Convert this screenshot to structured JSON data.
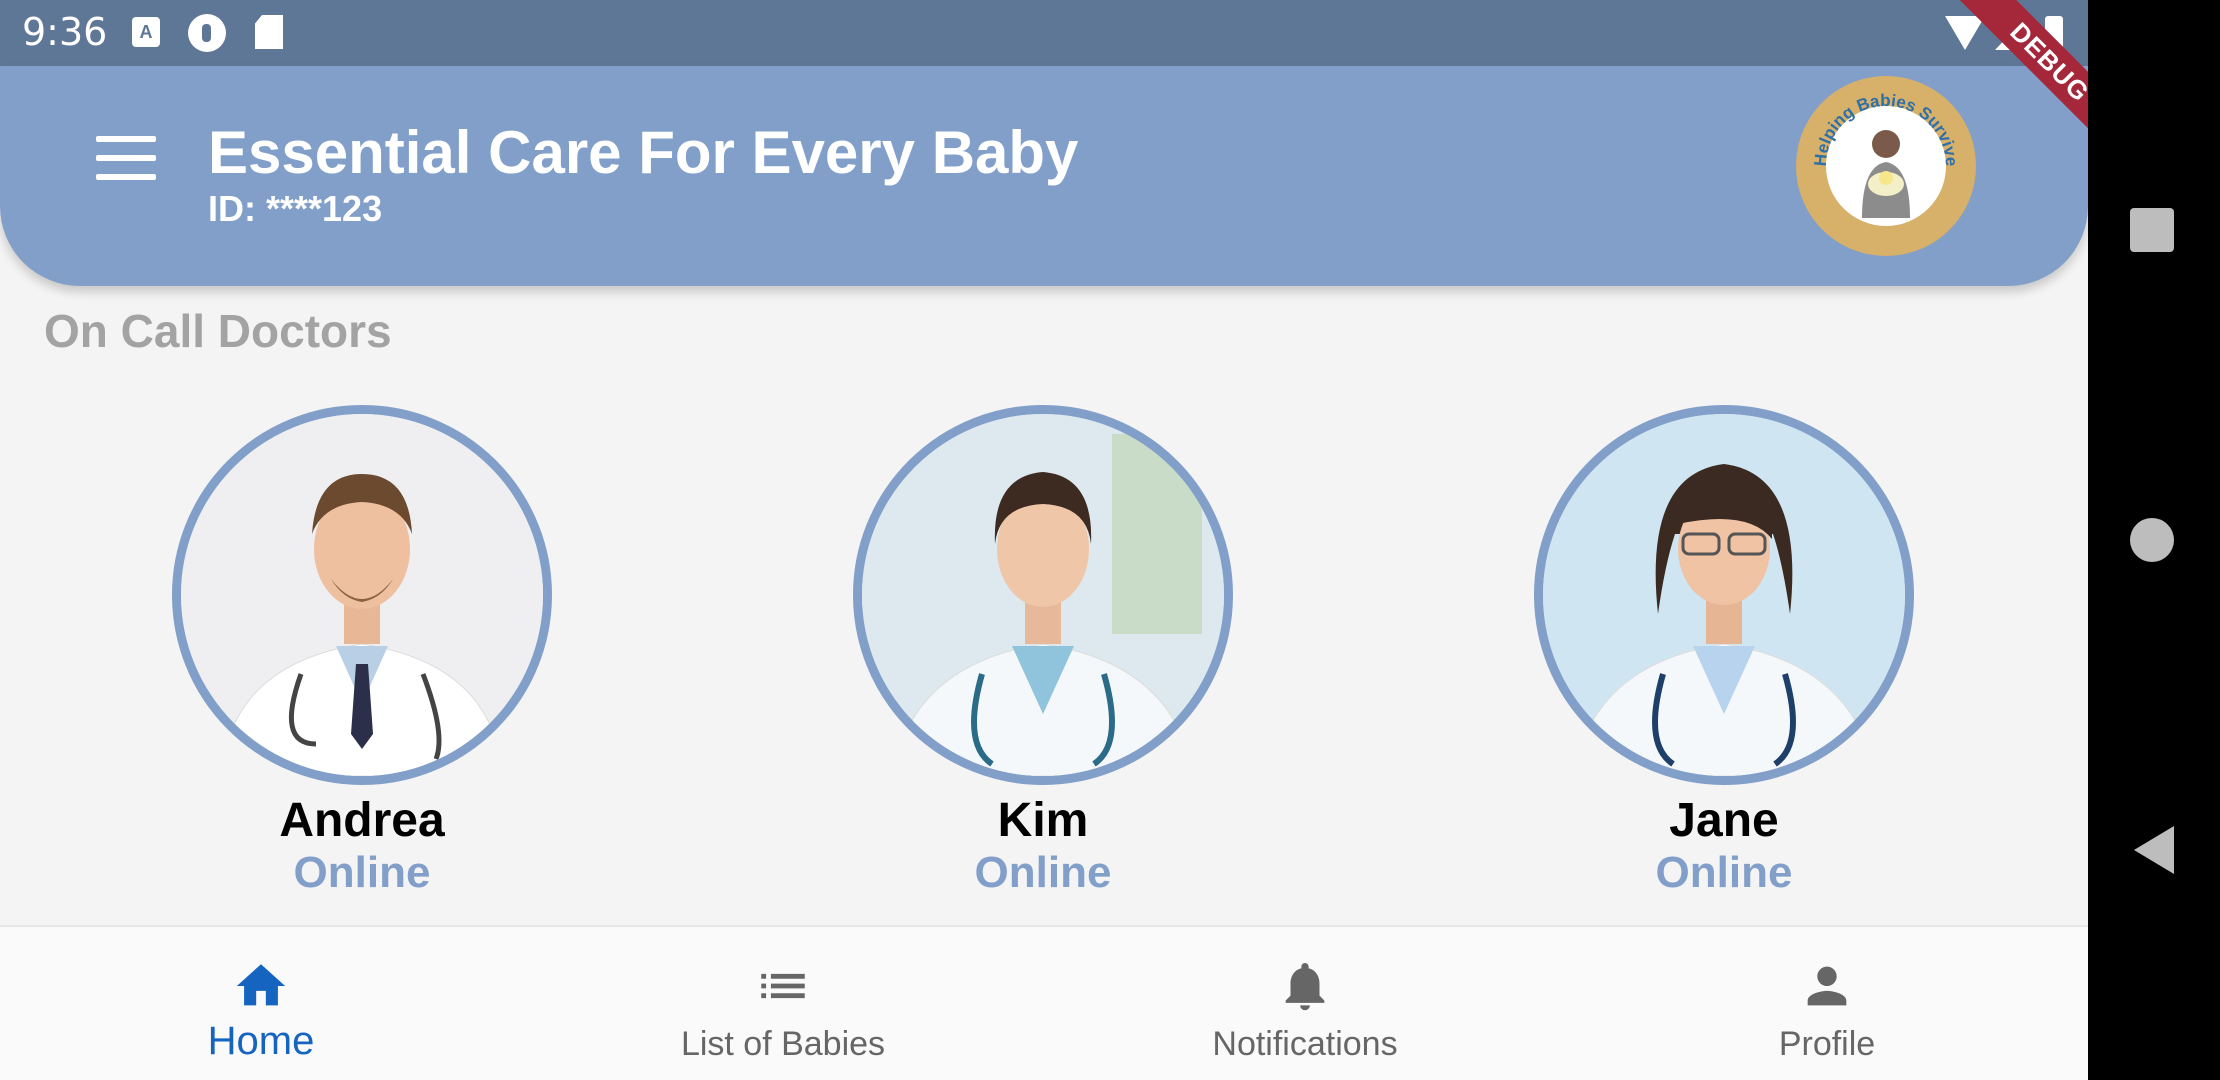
{
  "status_bar": {
    "time": "9:36",
    "icons": [
      "a-notification-icon",
      "app-notification-icon",
      "sd-card-icon",
      "wifi-icon",
      "signal-icon",
      "battery-icon"
    ],
    "debug_label": "DEBUG"
  },
  "header": {
    "title": "Essential Care For Every Baby",
    "subtitle": "ID: ****123",
    "logo_text": "Helping Babies Survive",
    "background": "#819fc9"
  },
  "section": {
    "title": "On Call Doctors"
  },
  "doctors": [
    {
      "name": "Andrea",
      "status": "Online"
    },
    {
      "name": "Kim",
      "status": "Online"
    },
    {
      "name": "Jane",
      "status": "Online"
    }
  ],
  "bottom_nav": {
    "items": [
      {
        "label": "Home",
        "icon": "home-icon",
        "active": true
      },
      {
        "label": "List of Babies",
        "icon": "list-icon",
        "active": false
      },
      {
        "label": "Notifications",
        "icon": "bell-icon",
        "active": false
      },
      {
        "label": "Profile",
        "icon": "person-icon",
        "active": false
      }
    ]
  },
  "colors": {
    "accent": "#819fc9",
    "active_nav": "#1565c0",
    "debug_ribbon": "#a4283a"
  }
}
